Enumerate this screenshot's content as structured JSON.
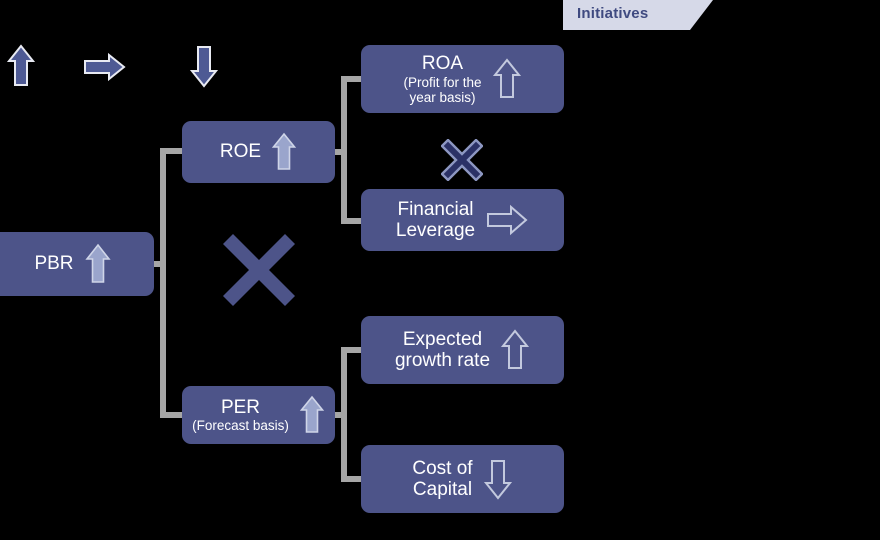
{
  "background_color": "#000000",
  "tab": {
    "label": "Initiatives",
    "background_color": "#d6d9e8",
    "text_color": "#3f4a80"
  },
  "legend": {
    "items": [
      {
        "icon": "arrow-up-icon",
        "direction": "up",
        "color": "#4e5a94"
      },
      {
        "icon": "arrow-right-icon",
        "direction": "right",
        "color": "#4e5a94"
      },
      {
        "icon": "arrow-down-icon",
        "direction": "down",
        "color": "#4e5a94"
      }
    ]
  },
  "palette": {
    "node_fill": "#4d5489",
    "node_text": "#ffffff",
    "arrow_filled": "#9aa5cc",
    "arrow_outline": "#c3c9de",
    "connector": "#a6a6a6",
    "cross_large": "#4d5489",
    "cross_small_fill": "#2b3166",
    "cross_small_border": "#8d97c2"
  },
  "diagram": {
    "root": {
      "label": "PBR",
      "arrow": {
        "icon": "arrow-up-icon",
        "direction": "up",
        "style": "filled"
      }
    },
    "branches": [
      {
        "label": "ROE",
        "sublabel": "",
        "arrow": {
          "icon": "arrow-up-icon",
          "direction": "up",
          "style": "filled"
        },
        "operator": {
          "icon": "multiply-icon",
          "symbol": "×"
        },
        "children": [
          {
            "label": "ROA",
            "sublabel": "(Profit for the\nyear basis)",
            "arrow": {
              "icon": "arrow-up-icon",
              "direction": "up",
              "style": "outline"
            }
          },
          {
            "label": "Financial\nLeverage",
            "sublabel": "",
            "arrow": {
              "icon": "arrow-right-icon",
              "direction": "right",
              "style": "outline"
            }
          }
        ]
      },
      {
        "label": "PER",
        "sublabel": "(Forecast basis)",
        "arrow": {
          "icon": "arrow-up-icon",
          "direction": "up",
          "style": "filled"
        },
        "operator": {
          "icon": "multiply-icon",
          "symbol": "×"
        },
        "children": [
          {
            "label": "Expected\ngrowth rate",
            "sublabel": "",
            "arrow": {
              "icon": "arrow-up-icon",
              "direction": "up",
              "style": "outline"
            }
          },
          {
            "label": "Cost of\nCapital",
            "sublabel": "",
            "arrow": {
              "icon": "arrow-down-icon",
              "direction": "down",
              "style": "outline"
            }
          }
        ]
      }
    ],
    "root_operator": {
      "icon": "multiply-icon",
      "symbol": "×"
    }
  }
}
